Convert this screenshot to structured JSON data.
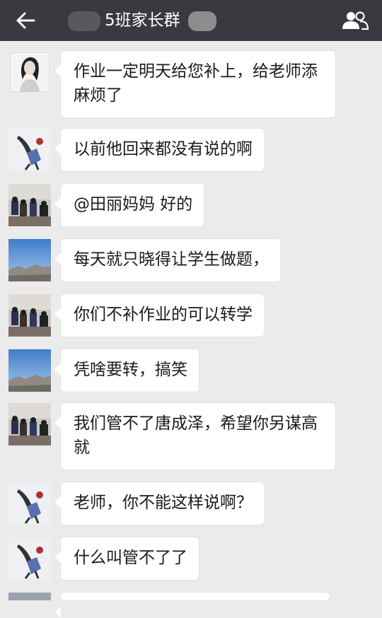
{
  "header": {
    "title": "5班家长群",
    "back_icon": "back-arrow-icon",
    "members_icon": "group-members-icon"
  },
  "messages": [
    {
      "avatar": "avatar-girl-portrait",
      "text": "作业一定明天给您补上，给老师添麻烦了"
    },
    {
      "avatar": "avatar-anime-figure",
      "text": "以前他回来都没有说的啊"
    },
    {
      "avatar": "avatar-classroom-photo",
      "text": "@田丽妈妈 好的"
    },
    {
      "avatar": "avatar-sky-landscape",
      "text": "每天就只晓得让学生做题，"
    },
    {
      "avatar": "avatar-classroom-photo",
      "text": "你们不补作业的可以转学"
    },
    {
      "avatar": "avatar-sky-landscape",
      "text": "凭啥要转，搞笑"
    },
    {
      "avatar": "avatar-classroom-photo",
      "text": "我们管不了唐成泽，希望你另谋高就"
    },
    {
      "avatar": "avatar-anime-figure",
      "text": "老师，你不能这样说啊？"
    },
    {
      "avatar": "avatar-anime-figure",
      "text": "什么叫管不了了"
    }
  ],
  "colors": {
    "titlebar": "#393a3f",
    "background": "#ebebeb",
    "bubble": "#ffffff"
  }
}
